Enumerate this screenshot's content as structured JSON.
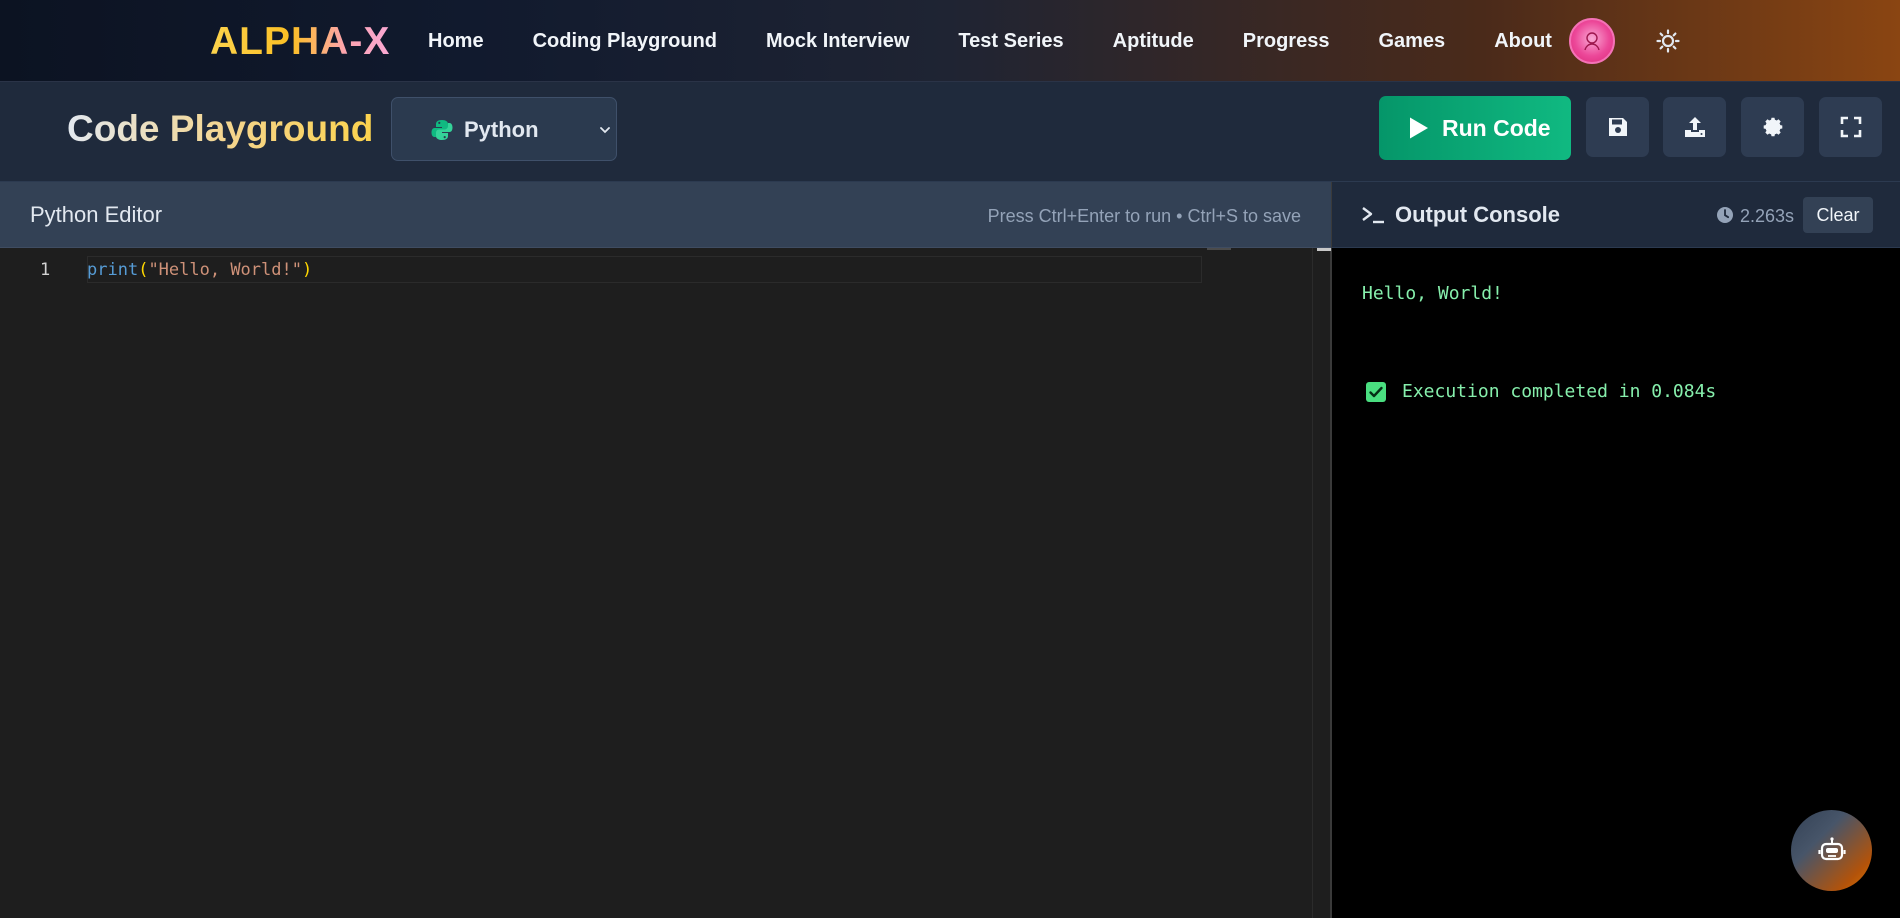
{
  "navbar": {
    "brand": "ALPHA-X",
    "links": [
      "Home",
      "Coding Playground",
      "Mock Interview",
      "Test Series",
      "Aptitude",
      "Progress",
      "Games",
      "About"
    ]
  },
  "toolbar": {
    "title": "Code Playground",
    "language": "Python",
    "run_label": "Run Code",
    "icons": [
      "save-icon",
      "upload-icon",
      "settings-icon",
      "fullscreen-icon"
    ]
  },
  "editor": {
    "title": "Python Editor",
    "hint": "Press Ctrl+Enter to run • Ctrl+S to save",
    "line_number": "1",
    "code": {
      "fn": "print",
      "open": "(",
      "str": "\"Hello, World!\"",
      "close": ")"
    }
  },
  "output": {
    "title": "Output Console",
    "time": "2.263s",
    "clear_label": "Clear",
    "lines": [
      "Hello, World!",
      "Execution completed in 0.084s"
    ]
  },
  "colors": {
    "accent_green": "#10b981",
    "brand_gold": "#fcd34d",
    "console_text": "#86efac"
  }
}
